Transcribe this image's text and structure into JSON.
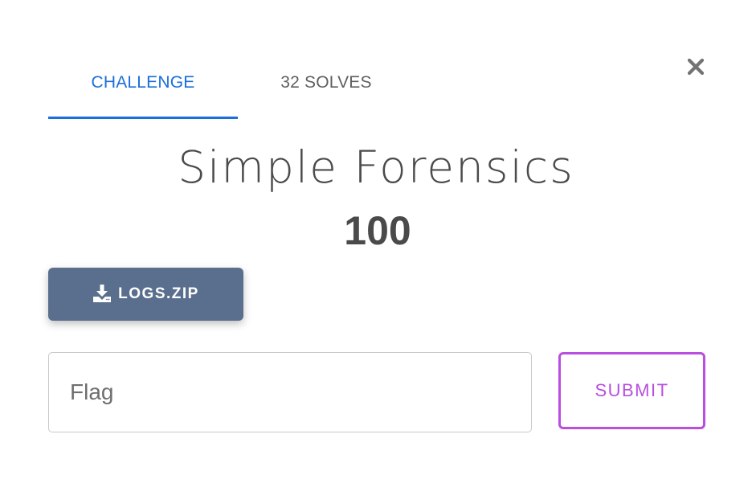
{
  "tabs": [
    {
      "label": "CHALLENGE",
      "active": true
    },
    {
      "label": "32 SOLVES",
      "active": false
    }
  ],
  "close": {
    "icon": "close-icon"
  },
  "challenge": {
    "name": "Simple Forensics",
    "value": "100"
  },
  "file": {
    "label": "LOGS.ZIP",
    "icon": "download-icon"
  },
  "flag": {
    "placeholder": "Flag",
    "value": ""
  },
  "submit": {
    "label": "SUBMIT"
  },
  "colors": {
    "accent": "#1a6fdc",
    "file_button": "#5a6f8e",
    "submit": "#b94ee0",
    "text": "#4b4b4b"
  }
}
